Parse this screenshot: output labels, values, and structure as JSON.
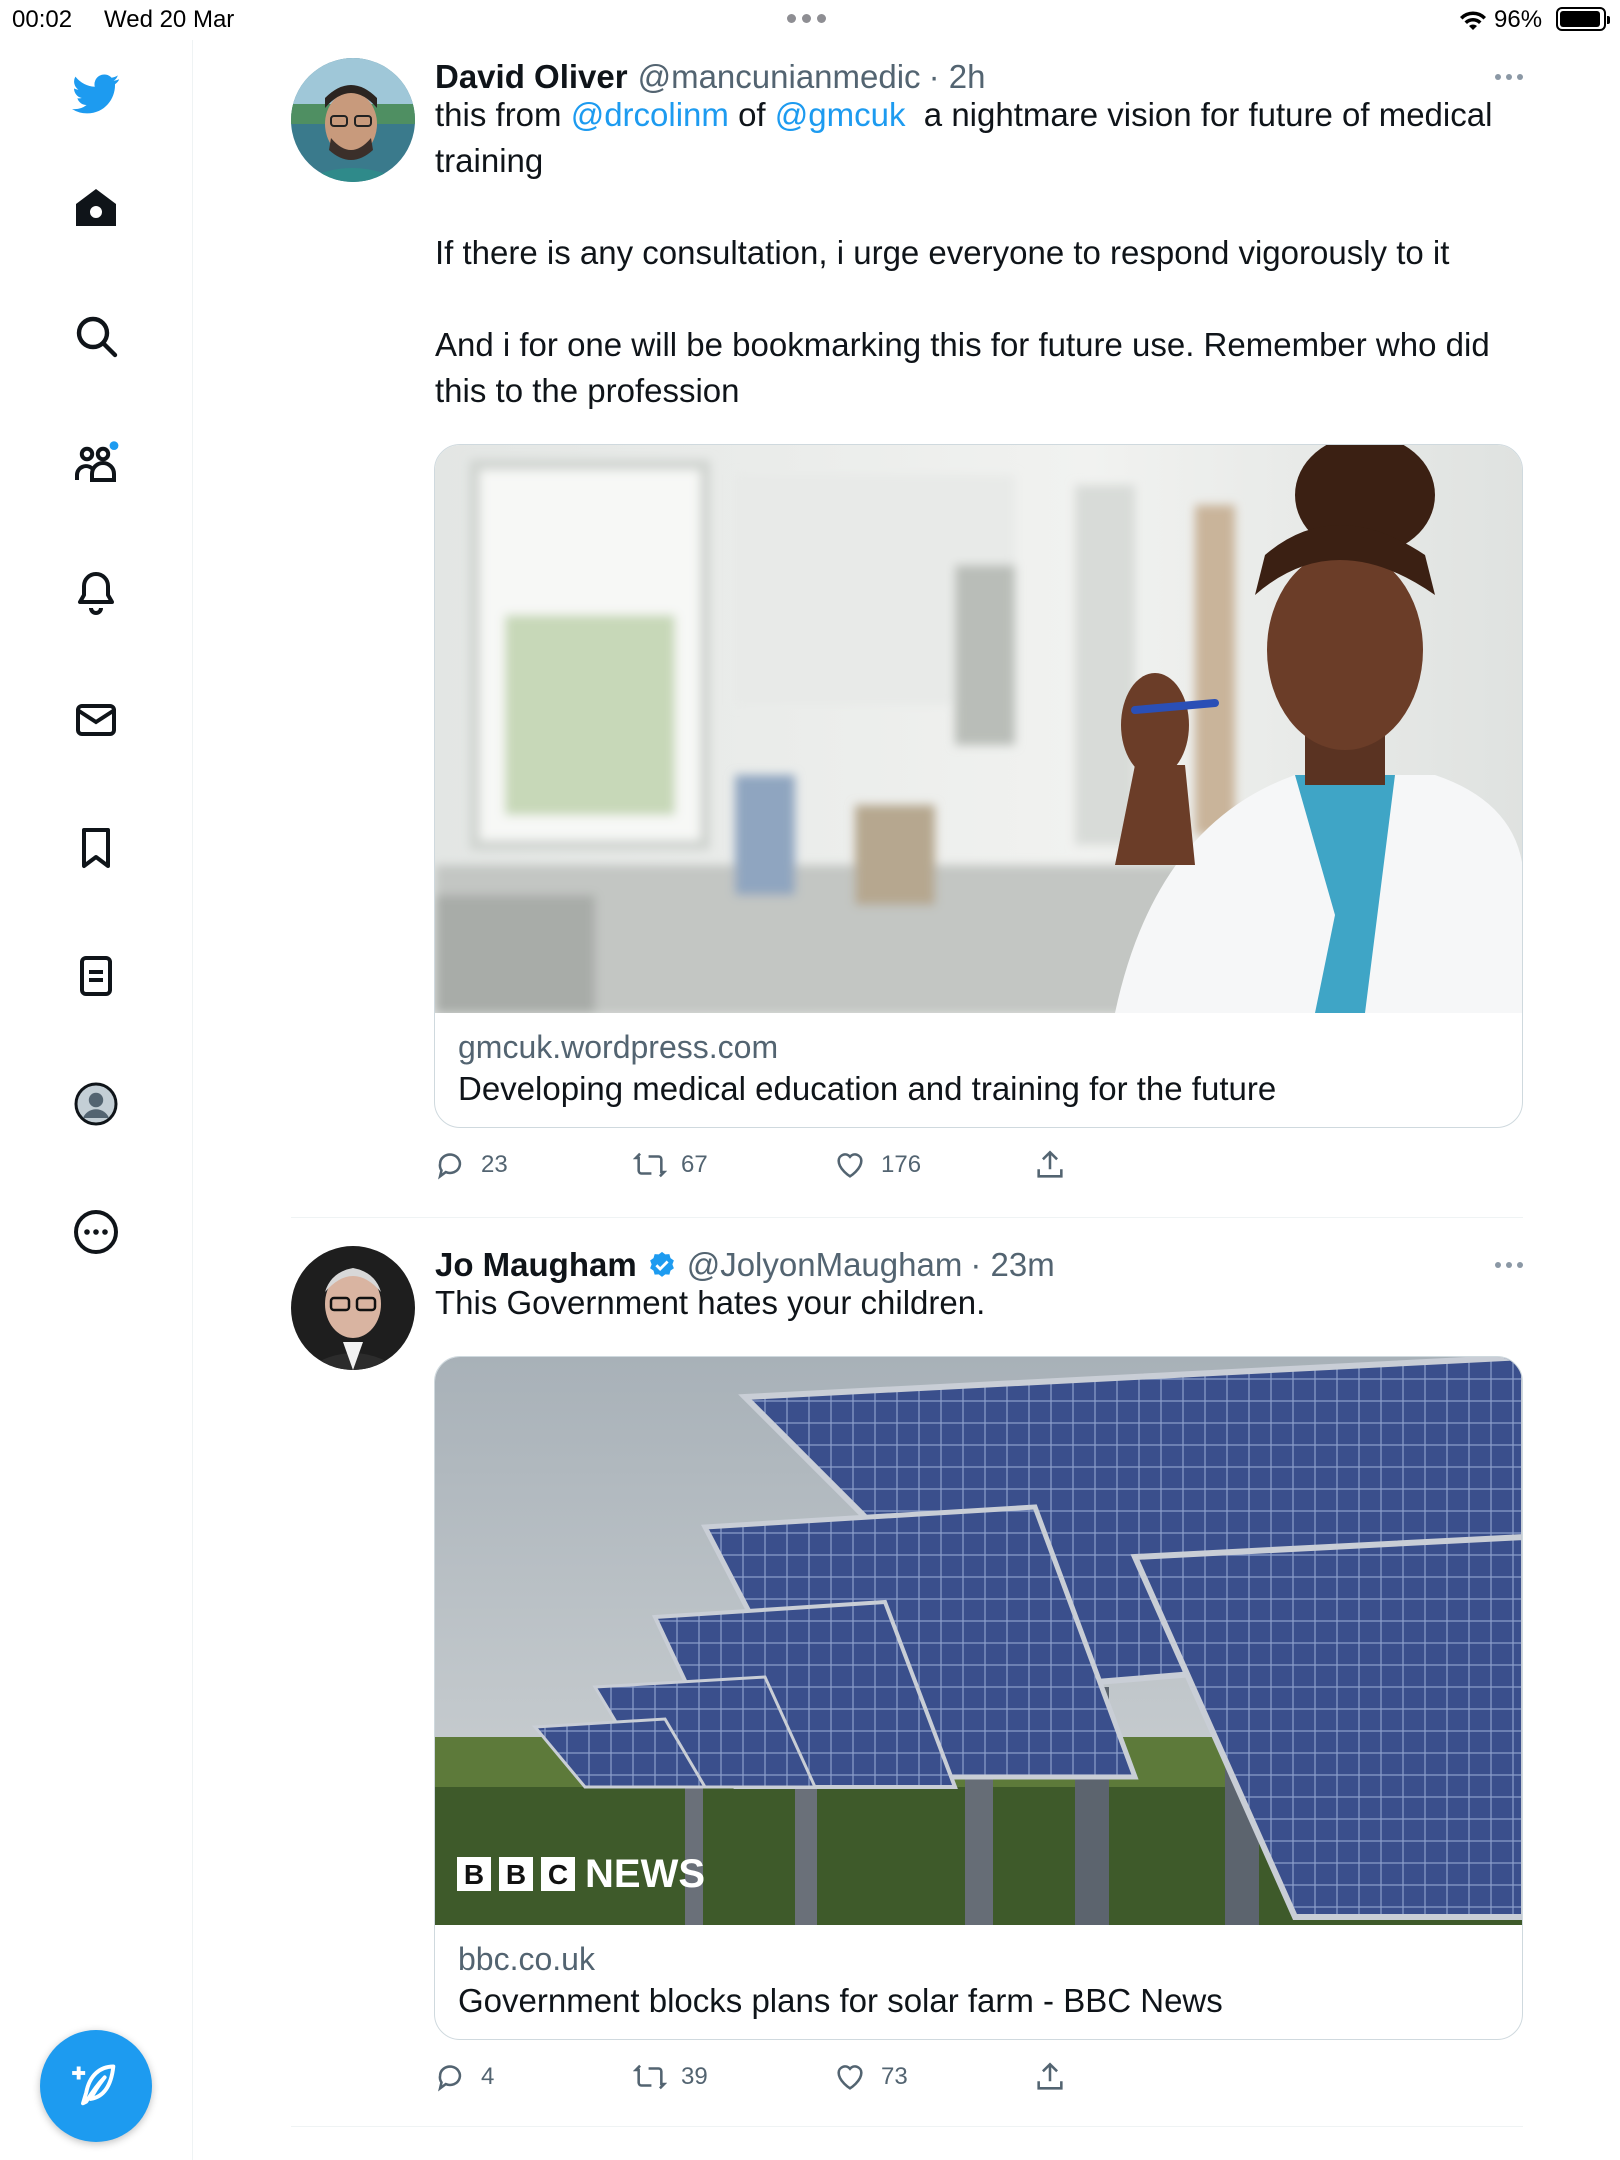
{
  "status_bar": {
    "time": "00:02",
    "date": "Wed 20 Mar",
    "battery": "96%",
    "battery_level": 0.96
  },
  "sidebar": {
    "items": [
      {
        "icon": "twitter-bird-logo"
      },
      {
        "icon": "home-icon"
      },
      {
        "icon": "search-icon"
      },
      {
        "icon": "communities-icon"
      },
      {
        "icon": "notifications-bell-icon"
      },
      {
        "icon": "messages-envelope-icon"
      },
      {
        "icon": "bookmarks-icon"
      },
      {
        "icon": "lists-icon"
      },
      {
        "icon": "profile-avatar-icon"
      },
      {
        "icon": "more-options-icon"
      }
    ],
    "compose_icon": "compose-tweet-icon"
  },
  "tweets": [
    {
      "name": "David Oliver",
      "handle": "@mancunianmedic",
      "time": "· 2h",
      "text_pre1": "this from ",
      "mention1": "@drcolinm",
      "text_mid": " of ",
      "mention2": "@gmcuk",
      "text_post": "  a nightmare vision for future of medical training\n\nIf there is any consultation, i urge everyone to respond vigorously to it\n\nAnd i for one will be bookmarking this for future use. Remember who did this to the profession",
      "card_domain": "gmcuk.wordpress.com",
      "card_title": "Developing medical education and training for the future",
      "replies": "23",
      "retweets": "67",
      "likes": "176"
    },
    {
      "name": "Jo Maugham",
      "handle": "@JolyonMaugham",
      "time": "· 23m",
      "verified": true,
      "text": "This Government hates your children.",
      "card_logo": "BBC NEWS",
      "card_domain": "bbc.co.uk",
      "card_title": "Government blocks plans for solar farm - BBC News",
      "replies": "4",
      "retweets": "39",
      "likes": "73"
    }
  ],
  "colors": {
    "accent": "#1d9bf0",
    "secondary_text": "#536471",
    "border": "#cfd9de"
  }
}
